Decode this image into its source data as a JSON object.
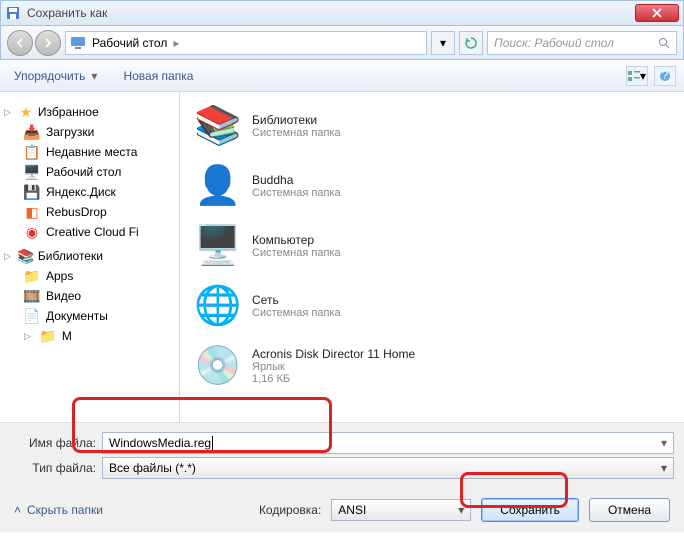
{
  "title": "Сохранить как",
  "breadcrumb": "Рабочий стол",
  "breadcrumb_sep": "▸",
  "search_placeholder": "Поиск: Рабочий стол",
  "toolbar": {
    "organize": "Упорядочить",
    "newfolder": "Новая папка"
  },
  "sidebar": {
    "fav": "Избранное",
    "items": [
      {
        "label": "Загрузки"
      },
      {
        "label": "Недавние места"
      },
      {
        "label": "Рабочий стол"
      },
      {
        "label": "Яндекс.Диск"
      },
      {
        "label": "RebusDrop"
      },
      {
        "label": "Creative Cloud Fi"
      }
    ],
    "lib": "Библиотеки",
    "libs": [
      {
        "label": "Apps"
      },
      {
        "label": "Видео"
      },
      {
        "label": "Документы"
      },
      {
        "label": "М"
      }
    ]
  },
  "main": [
    {
      "title": "Библиотеки",
      "sub": "Системная папка"
    },
    {
      "title": "Buddha",
      "sub": "Системная папка"
    },
    {
      "title": "Компьютер",
      "sub": "Системная папка"
    },
    {
      "title": "Сеть",
      "sub": "Системная папка"
    },
    {
      "title": "Acronis Disk Director 11 Home",
      "sub": "Ярлык",
      "sub2": "1,16 КБ"
    }
  ],
  "form": {
    "file_label": "Имя файла:",
    "file_value": "WindowsMedia.reg",
    "type_label": "Тип файла:",
    "type_value": "Все файлы  (*.*)",
    "enc_label": "Кодировка:",
    "enc_value": "ANSI",
    "hide": "Скрыть папки",
    "save": "Сохранить",
    "cancel": "Отмена"
  }
}
